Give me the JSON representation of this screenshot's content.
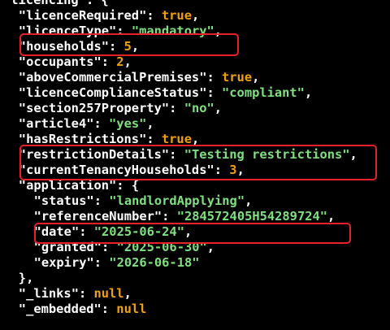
{
  "json_viewer": {
    "indent_unit": "  ",
    "lines": [
      {
        "indent": 0,
        "key": "licencing",
        "open": "{"
      },
      {
        "indent": 1,
        "key": "licenceRequired",
        "value": "true",
        "vtype": "b",
        "comma": ","
      },
      {
        "indent": 1,
        "key": "licenceType",
        "value": "\"mandatory\"",
        "vtype": "s",
        "comma": ","
      },
      {
        "indent": 1,
        "key": "households",
        "value": "5",
        "vtype": "n",
        "comma": ","
      },
      {
        "indent": 1,
        "key": "occupants",
        "value": "2",
        "vtype": "n",
        "comma": ","
      },
      {
        "indent": 1,
        "key": "aboveCommercialPremises",
        "value": "true",
        "vtype": "b",
        "comma": ","
      },
      {
        "indent": 1,
        "key": "licenceComplianceStatus",
        "value": "\"compliant\"",
        "vtype": "s",
        "comma": ","
      },
      {
        "indent": 1,
        "key": "section257Property",
        "value": "\"no\"",
        "vtype": "s",
        "comma": ","
      },
      {
        "indent": 1,
        "key": "article4",
        "value": "\"yes\"",
        "vtype": "s",
        "comma": ","
      },
      {
        "indent": 1,
        "key": "hasRestrictions",
        "value": "true",
        "vtype": "b",
        "comma": ","
      },
      {
        "indent": 1,
        "key": "restrictionDetails",
        "value": "\"Testing restrictions\"",
        "vtype": "s",
        "comma": ","
      },
      {
        "indent": 1,
        "key": "currentTenancyHouseholds",
        "value": "3",
        "vtype": "n",
        "comma": ","
      },
      {
        "indent": 1,
        "key": "application",
        "open": "{"
      },
      {
        "indent": 2,
        "key": "status",
        "value": "\"landlordApplying\"",
        "vtype": "s",
        "comma": ","
      },
      {
        "indent": 2,
        "key": "referenceNumber",
        "value": "\"284572405H54289724\"",
        "vtype": "s",
        "comma": ","
      },
      {
        "indent": 2,
        "key": "date",
        "value": "\"2025-06-24\"",
        "vtype": "s",
        "comma": ","
      },
      {
        "indent": 2,
        "key": "granted",
        "value": "\"2025-06-30\"",
        "vtype": "s",
        "comma": ","
      },
      {
        "indent": 2,
        "key": "expiry",
        "value": "\"2026-06-18\"",
        "vtype": "s",
        "comma": ""
      },
      {
        "indent": 1,
        "close": "},"
      },
      {
        "indent": 1,
        "key": "_links",
        "value": "null",
        "vtype": "x",
        "comma": ","
      },
      {
        "indent": 1,
        "key": "_embedded",
        "value": "null",
        "vtype": "x",
        "comma": ""
      }
    ]
  },
  "colors": {
    "background": "#000000",
    "key": "#ffffff",
    "string": "#7ee07e",
    "boolean": "#f0a010",
    "number": "#f0a010",
    "null": "#f0a010",
    "highlight_border": "#e8202a"
  }
}
